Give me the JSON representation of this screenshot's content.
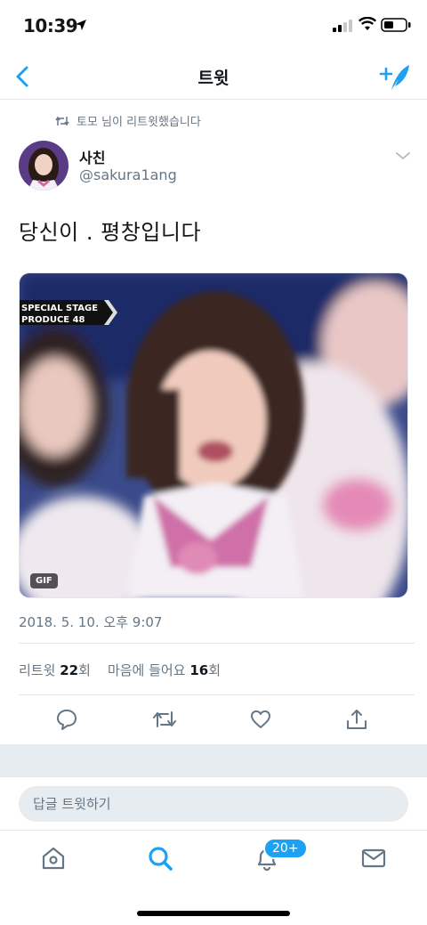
{
  "status_bar": {
    "time": "10:39"
  },
  "nav": {
    "title": "트윗"
  },
  "retweet_context": {
    "text": "토모 님이 리트윗했습니다"
  },
  "tweet": {
    "display_name": "사친",
    "handle": "@sakura1ang",
    "text": "당신이 . 평창입니다",
    "media": {
      "overlay_line1": "SPECIAL STAGE",
      "overlay_line2": "PRODUCE 48",
      "badge": "GIF"
    },
    "timestamp": "2018. 5. 10. 오후 9:07",
    "retweets_label": "리트윗",
    "retweets_count": "22",
    "retweets_unit": "회",
    "likes_label": "마음에 들어요",
    "likes_count": "16",
    "likes_unit": "회"
  },
  "reply": {
    "placeholder": "답글 트윗하기"
  },
  "tabs": {
    "notif_badge": "20+"
  },
  "colors": {
    "accent": "#1da1f2",
    "muted": "#657786",
    "text": "#14171a"
  }
}
